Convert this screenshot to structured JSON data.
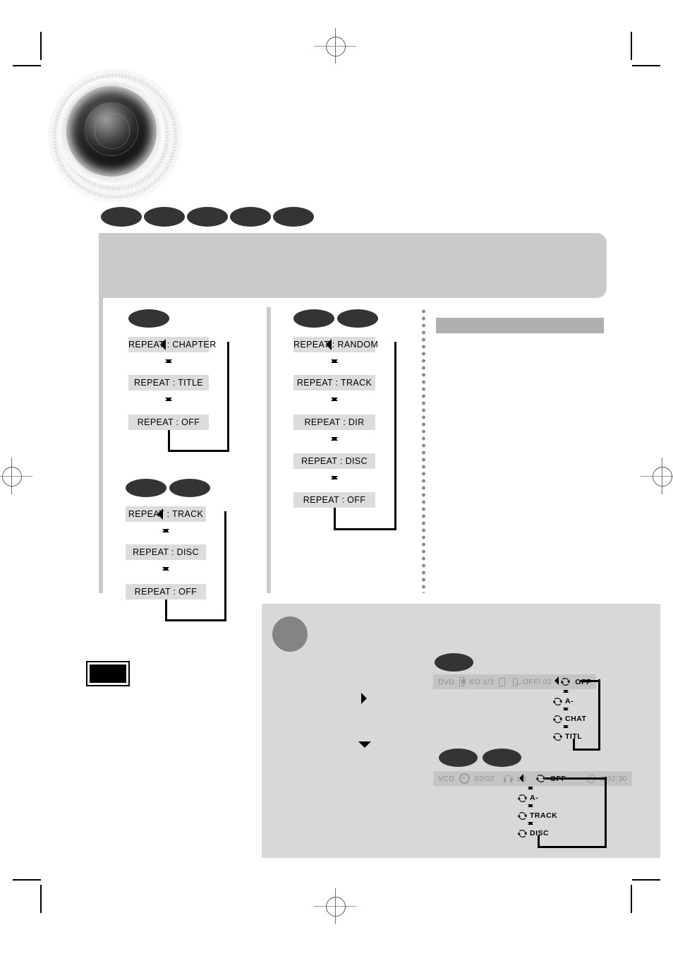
{
  "page": {
    "kind": "scanned-manual-page",
    "page_number_label": "",
    "title_banner_text": "",
    "section_header_text": ""
  },
  "emblem": {
    "name": "speaker-cone-emblem",
    "digit_ring_text": "01010101010101010101010101010101010101"
  },
  "title_row": {
    "disc_badge_count": 5,
    "badges": [
      "",
      "",
      "",
      "",
      ""
    ]
  },
  "flows": [
    {
      "id": "flow-dvd",
      "badges": [
        ""
      ],
      "badge_count": 1,
      "steps": [
        "REPEAT : CHAPTER",
        "REPEAT : TITLE",
        "REPEAT : OFF"
      ]
    },
    {
      "id": "flow-cd",
      "badges": [
        "",
        ""
      ],
      "badge_count": 2,
      "steps": [
        "REPEAT : TRACK",
        "REPEAT : DISC",
        "REPEAT : OFF"
      ]
    },
    {
      "id": "flow-mp3",
      "badges": [
        "",
        ""
      ],
      "badge_count": 2,
      "steps": [
        "REPEAT : RANDOM",
        "REPEAT : TRACK",
        "REPEAT : DIR",
        "REPEAT : DISC",
        "REPEAT : OFF"
      ]
    }
  ],
  "note_panel": {
    "badge_label": "",
    "marker_right": "▶",
    "marker_down": "▼",
    "osd_dvd": {
      "badges": [
        ""
      ],
      "badge_count": 1,
      "fields": [
        {
          "name": "disc-type",
          "text": "DVD"
        },
        {
          "name": "angle-icon",
          "text": ""
        },
        {
          "name": "audio-language",
          "text": "KO 1/3"
        },
        {
          "name": "dolby-digital-icon",
          "text": "DOLBY"
        },
        {
          "name": "subtitle-icon",
          "text": ""
        },
        {
          "name": "subtitle-value",
          "text": "OFF/ 02"
        }
      ],
      "repeat_current": "OFF",
      "repeat_sequence": [
        "OFF",
        "A-",
        "CHAT",
        "TITL"
      ]
    },
    "osd_vcd": {
      "badges": [
        "",
        ""
      ],
      "badge_count": 2,
      "fields": [
        {
          "name": "disc-type",
          "text": "VCD"
        },
        {
          "name": "disc-icon",
          "text": ""
        },
        {
          "name": "track-number",
          "text": "02/02"
        },
        {
          "name": "headphone-icon",
          "text": ""
        },
        {
          "name": "audio-channel",
          "text": "LR"
        }
      ],
      "repeat_current": "OFF",
      "elapsed_time": "0:02:30",
      "repeat_sequence": [
        "OFF",
        "A-",
        "TRACK",
        "DISC"
      ]
    }
  },
  "colors": {
    "redaction": "#343434",
    "banner_gray": "#cacaca",
    "box_gray": "#dcdcdc",
    "panel_gray": "#d8d8d8",
    "header_gray": "#b0b0b0",
    "osd_gray": "#c4c4c4",
    "osd_text": "#8f8f8f"
  }
}
